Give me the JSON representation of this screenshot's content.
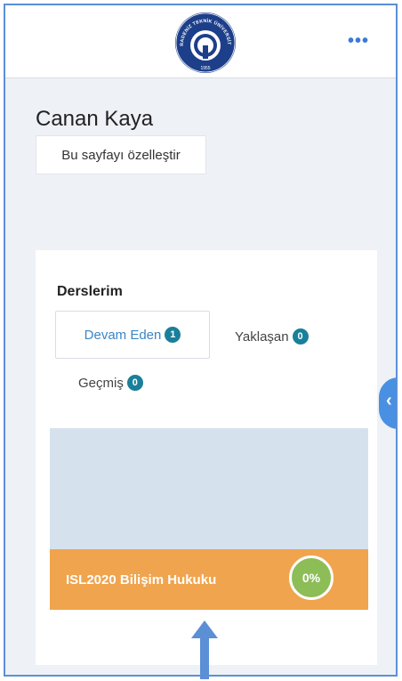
{
  "header": {
    "logo_text": "KARADENİZ TEKNİK ÜNİVERSİTESİ",
    "logo_year": "1955",
    "more_label": "•••"
  },
  "user": {
    "name": "Canan Kaya"
  },
  "customize_button": "Bu sayfayı özelleştir",
  "courses_section": {
    "title": "Derslerim",
    "tabs": [
      {
        "label": "Devam Eden",
        "count": "1",
        "active": true
      },
      {
        "label": "Yaklaşan",
        "count": "0",
        "active": false
      },
      {
        "label": "Geçmiş",
        "count": "0",
        "active": false
      }
    ],
    "course": {
      "name": "ISL2020 Bilişim Hukuku",
      "progress": "0%"
    }
  },
  "drawer_toggle_icon": "‹",
  "colors": {
    "accent": "#3a86c8",
    "badge": "#1a7f9a",
    "course_footer": "#f0a44d",
    "course_image": "#d5e2ee",
    "progress": "#8dbd57",
    "annotation_arrow": "#5b8fd6"
  }
}
